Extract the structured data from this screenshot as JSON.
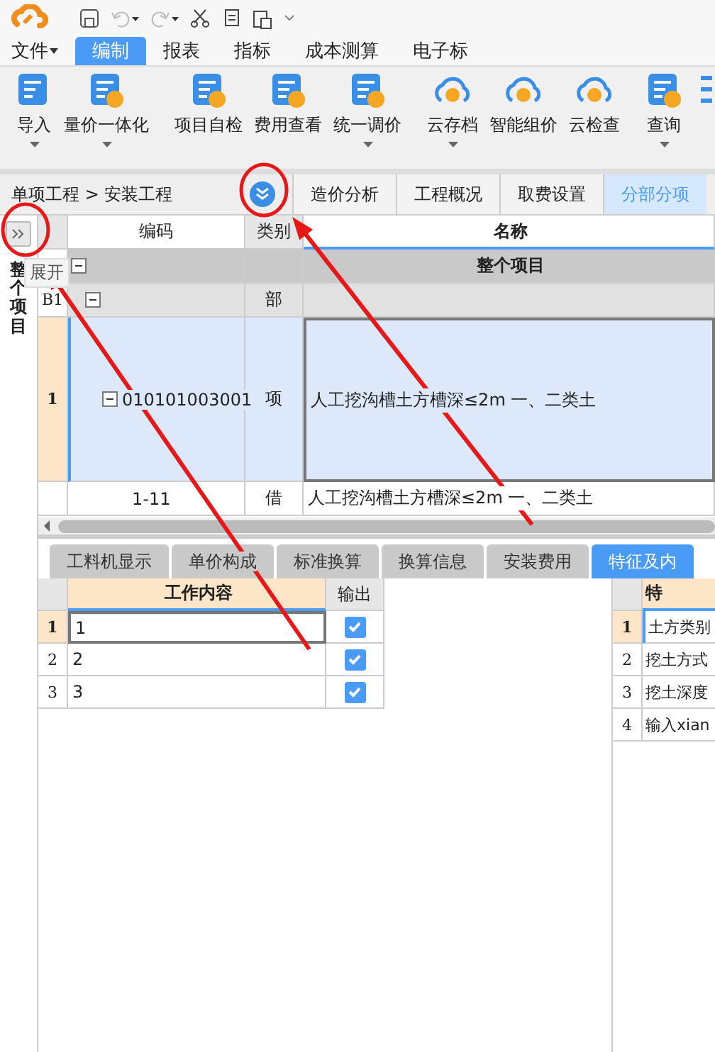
{
  "menu_tabs": [
    {
      "label": "文件",
      "selected": false,
      "dropdown": true
    },
    {
      "label": "编制",
      "selected": true,
      "dropdown": false
    },
    {
      "label": "报表",
      "selected": false,
      "dropdown": false
    },
    {
      "label": "指标",
      "selected": false,
      "dropdown": false
    },
    {
      "label": "成本测算",
      "selected": false,
      "dropdown": false
    },
    {
      "label": "电子标",
      "selected": false,
      "dropdown": false
    }
  ],
  "ribbon": [
    {
      "label": "导入",
      "kind": "doc",
      "dropdown": true
    },
    {
      "label": "量价一体化",
      "kind": "doc",
      "dropdown": true
    },
    {
      "label": "项目自检",
      "kind": "doc",
      "dropdown": false
    },
    {
      "label": "费用查看",
      "kind": "doc",
      "dropdown": false
    },
    {
      "label": "统一调价",
      "kind": "doc",
      "dropdown": true
    },
    {
      "label": "云存档",
      "kind": "cloud",
      "dropdown": true
    },
    {
      "label": "智能组价",
      "kind": "cloud",
      "dropdown": false
    },
    {
      "label": "云检查",
      "kind": "cloud",
      "dropdown": false
    },
    {
      "label": "查询",
      "kind": "doc",
      "dropdown": true
    }
  ],
  "breadcrumb": "单项工程 > 安装工程",
  "view_tabs": [
    {
      "label": "造价分析",
      "selected": false
    },
    {
      "label": "工程概况",
      "selected": false
    },
    {
      "label": "取费设置",
      "selected": false
    },
    {
      "label": "分部分项",
      "selected": true
    }
  ],
  "side_panel": {
    "title": "整个项目",
    "tooltip": "展开"
  },
  "table": {
    "columns": [
      "编码",
      "类别",
      "名称"
    ],
    "rows": [
      {
        "kind": "root",
        "row_number": "",
        "code": "",
        "type": "",
        "name": "整个项目",
        "selected": false
      },
      {
        "kind": "section",
        "row_number": "B1",
        "code": "",
        "type": "部",
        "name": "",
        "selected": false
      },
      {
        "kind": "item",
        "row_number": "1",
        "code": "010101003001",
        "type": "项",
        "name": "人工挖沟槽土方槽深≤2m 一、二类土",
        "selected": true
      },
      {
        "kind": "sub",
        "row_number": "",
        "code": "1-11",
        "type": "借",
        "name": "人工挖沟槽土方槽深≤2m 一、二类土",
        "selected": false
      }
    ]
  },
  "bottom_tabs": [
    {
      "label": "工料机显示",
      "selected": false
    },
    {
      "label": "单价构成",
      "selected": false
    },
    {
      "label": "标准换算",
      "selected": false
    },
    {
      "label": "换算信息",
      "selected": false
    },
    {
      "label": "安装费用",
      "selected": false
    },
    {
      "label": "特征及内",
      "selected": true
    }
  ],
  "work_content": {
    "columns": [
      "工作内容",
      "输出"
    ],
    "rows": [
      {
        "row_number": "1",
        "content": "1",
        "output": true,
        "selected": true
      },
      {
        "row_number": "2",
        "content": "2",
        "output": true,
        "selected": false
      },
      {
        "row_number": "3",
        "content": "3",
        "output": true,
        "selected": false
      }
    ]
  },
  "features": {
    "columns": [
      "特"
    ],
    "rows": [
      {
        "row_number": "1",
        "text": "土方类别",
        "selected": true
      },
      {
        "row_number": "2",
        "text": "挖土方式",
        "selected": false
      },
      {
        "row_number": "3",
        "text": "挖土深度",
        "selected": false
      },
      {
        "row_number": "4",
        "text": "输入xian",
        "selected": false
      }
    ]
  }
}
